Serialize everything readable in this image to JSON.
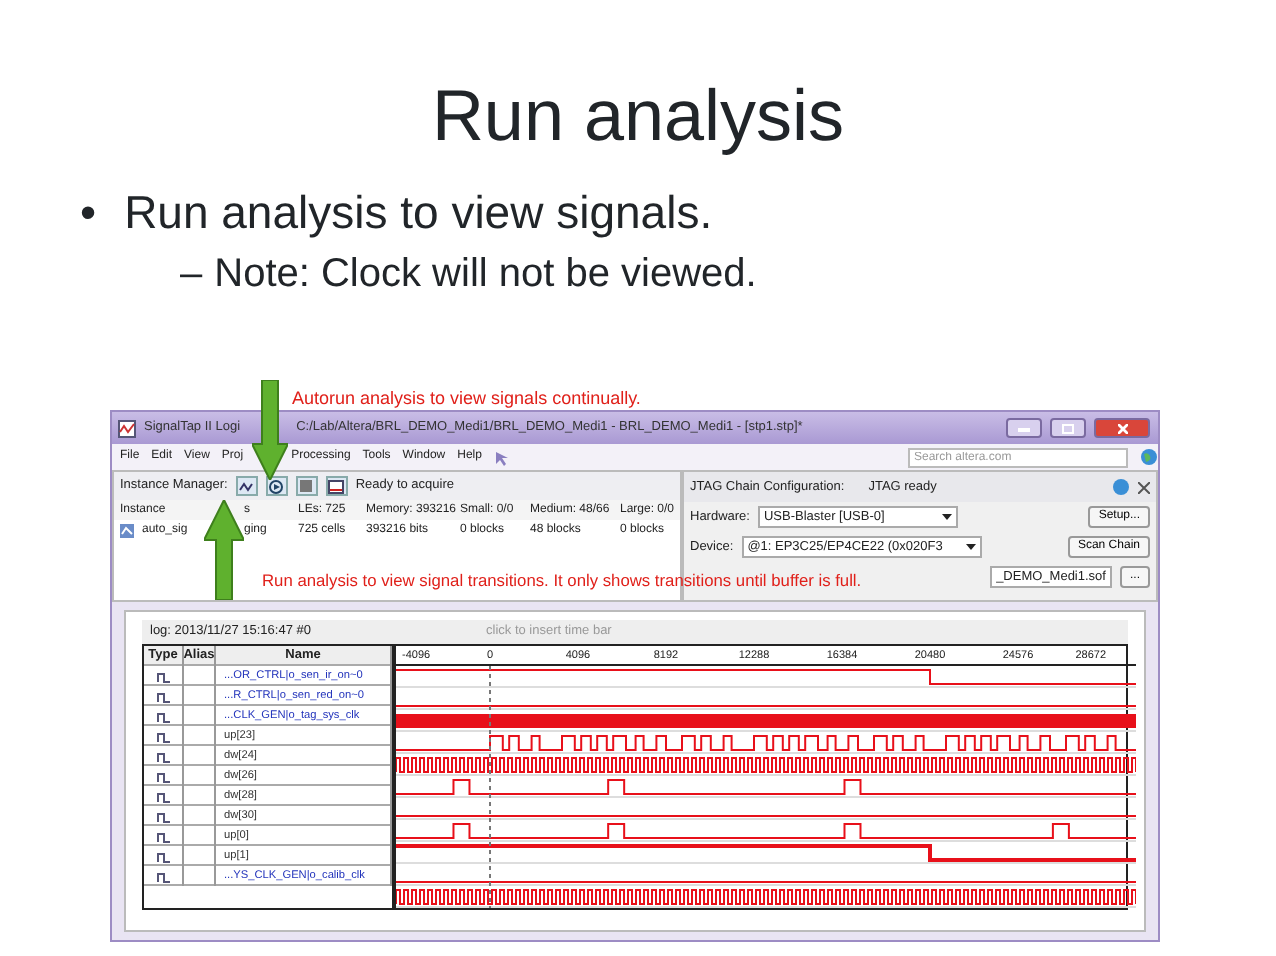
{
  "slide": {
    "title": "Run analysis",
    "bullets": [
      {
        "marker": "•",
        "text": "Run analysis to view signals.",
        "children": [
          {
            "marker": "–",
            "text": "Note: Clock will not be viewed."
          }
        ]
      }
    ]
  },
  "callouts": [
    {
      "kind": "down",
      "text": "Autorun analysis to view signals continually."
    },
    {
      "kind": "up",
      "text": "Run analysis to view signal transitions. It only shows transitions until buffer is full."
    }
  ],
  "window": {
    "title": "SignalTap II Logi",
    "path": "C:/Lab/Altera/BRL_DEMO_Medi1/BRL_DEMO_Medi1 - BRL_DEMO_Medi1 - [stp1.stp]*",
    "menu": [
      "File",
      "Edit",
      "View",
      "Proj",
      "Processing",
      "Tools",
      "Window",
      "Help"
    ],
    "search": {
      "placeholder": "Search altera.com"
    }
  },
  "instance_manager": {
    "label": "Instance Manager:",
    "status": "Ready to acquire",
    "columns": [
      "Instance",
      "s",
      "LEs: 725",
      "Memory: 393216",
      "Small: 0/0",
      "Medium: 48/66",
      "Large: 0/0"
    ],
    "rows": [
      [
        "auto_sig",
        "ging",
        "725 cells",
        "393216 bits",
        "0 blocks",
        "48 blocks",
        "0 blocks"
      ]
    ]
  },
  "jtag": {
    "title": "JTAG Chain Configuration:",
    "status": "JTAG ready",
    "hardware_label": "Hardware:",
    "hardware": "USB-Blaster [USB-0]",
    "setup_button": "Setup...",
    "device_label": "Device:",
    "device": "@1: EP3C25/EP4CE22 (0x020F3",
    "scan_button": "Scan Chain",
    "file": "_DEMO_Medi1.sof",
    "browse_button": "..."
  },
  "waveform": {
    "log": "log: 2013/11/27 15:16:47  #0",
    "hint": "click to insert time bar",
    "columns": [
      "Type",
      "Alias",
      "Name"
    ],
    "ticks": [
      "-4096",
      "0",
      "4096",
      "8192",
      "12288",
      "16384",
      "20480",
      "24576",
      "28672"
    ],
    "signals": [
      {
        "name": "...OR_CTRL|o_sen_ir_on~0",
        "kind": "fall"
      },
      {
        "name": "...R_CTRL|o_sen_red_on~0",
        "kind": "low"
      },
      {
        "name": "...CLK_GEN|o_tag_sys_clk",
        "kind": "dense"
      },
      {
        "name": "up[23]",
        "kind": "square"
      },
      {
        "name": "dw[24]",
        "kind": "clock"
      },
      {
        "name": "dw[26]",
        "kind": "pulses-short"
      },
      {
        "name": "dw[28]",
        "kind": "low"
      },
      {
        "name": "dw[30]",
        "kind": "pulses-long"
      },
      {
        "name": "up[0]",
        "kind": "bold-fall"
      },
      {
        "name": "up[1]",
        "kind": "low"
      },
      {
        "name": "...YS_CLK_GEN|o_calib_clk",
        "kind": "clock"
      }
    ]
  }
}
